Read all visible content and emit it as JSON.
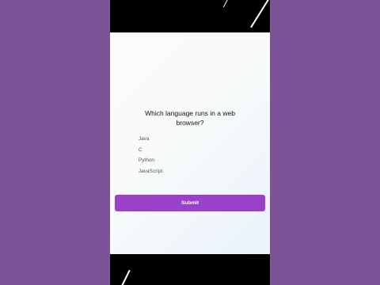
{
  "quiz": {
    "question": "Which language runs in a web browser?",
    "options": [
      {
        "label": "Java"
      },
      {
        "label": "C"
      },
      {
        "label": "Python"
      },
      {
        "label": "JavaScript"
      }
    ],
    "submit_label": "Submit"
  },
  "colors": {
    "page_background": "#7e5296",
    "submit_button": "#9b41c9",
    "screen_background": "#fbfcf9"
  }
}
